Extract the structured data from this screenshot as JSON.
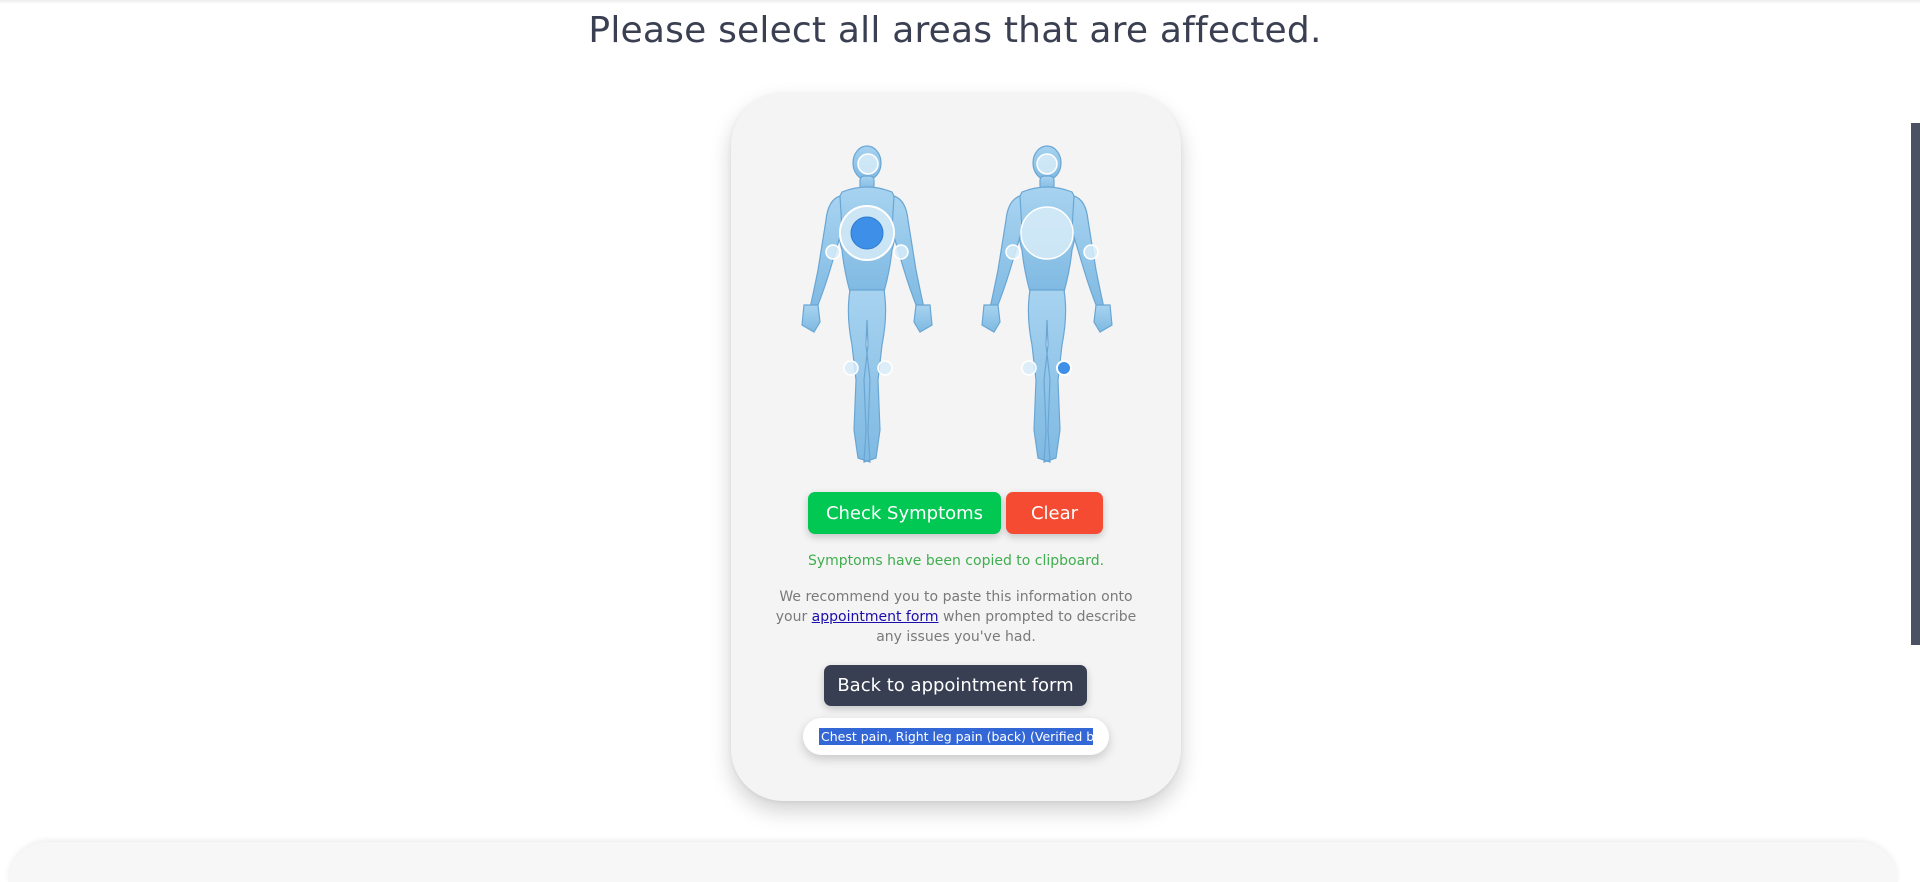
{
  "page": {
    "heading": "Please select all areas that are affected."
  },
  "body_map": {
    "views": [
      "front",
      "back"
    ],
    "selected_areas": [
      "Chest (front)",
      "Right knee (back)"
    ]
  },
  "actions": {
    "check_label": "Check Symptoms",
    "clear_label": "Clear",
    "back_label": "Back to appointment form"
  },
  "status": {
    "copied_message": "Symptoms have been copied to clipboard."
  },
  "recommendation": {
    "before_link": "We recommend you to paste this information onto your ",
    "link_text": "appointment form",
    "after_link": " when prompted to describe any issues you've had."
  },
  "result": {
    "text": "Chest pain, Right leg pain (back) (Verified by"
  },
  "colors": {
    "check": "#00c853",
    "clear": "#f54b32",
    "back": "#393f52",
    "success_text": "#3fae4e",
    "body": "#8ec5e8",
    "selected": "#3d8fe8"
  }
}
